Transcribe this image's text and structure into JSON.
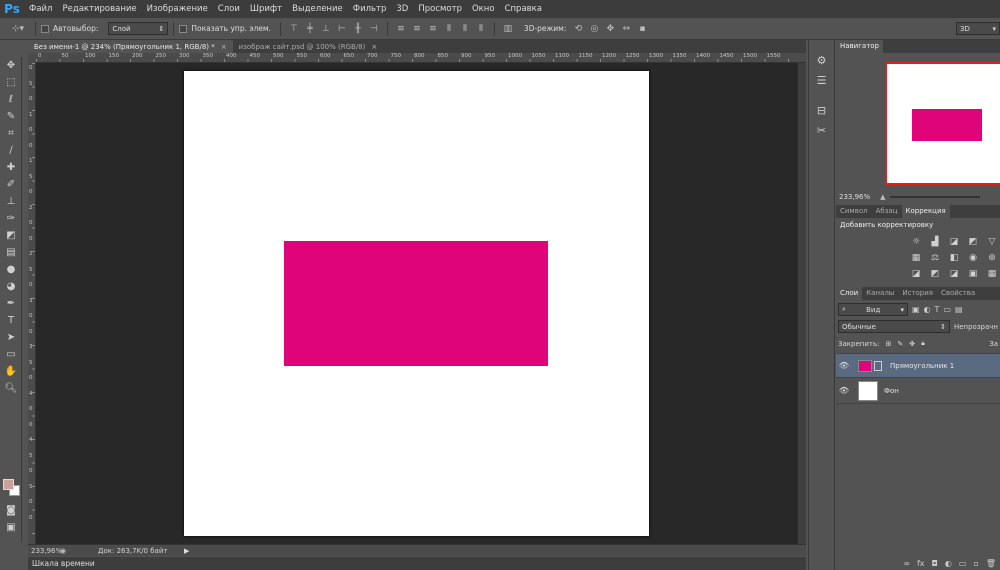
{
  "app": {
    "logo": "Ps",
    "menu": [
      "Файл",
      "Редактирование",
      "Изображение",
      "Слои",
      "Шрифт",
      "Выделение",
      "Фильтр",
      "3D",
      "Просмотр",
      "Окно",
      "Справка"
    ]
  },
  "options": {
    "autoselect_label": "Автовыбор:",
    "autoselect_value": "Слой",
    "show_transform_label": "Показать упр. элем.",
    "mode3d_label": "3D-режим:",
    "workspace_value": "3D"
  },
  "tabs": [
    {
      "label": "Без имени-1 @ 234% (Прямоугольник 1, RGB/8) *",
      "close": "×"
    },
    {
      "label": "изображ сайт.psd @ 100% (RGB/8)",
      "close": "×"
    }
  ],
  "ruler": {
    "h": [
      "0",
      "50",
      "100",
      "150",
      "200",
      "250",
      "300",
      "350",
      "400",
      "450",
      "500",
      "550",
      "600",
      "650",
      "700",
      "750",
      "800",
      "850",
      "900",
      "950",
      "1000",
      "1050",
      "1100",
      "1150",
      "1200",
      "1250",
      "1300",
      "1350",
      "1400",
      "1450",
      "1500",
      "1550"
    ],
    "v": [
      "0",
      "5",
      "0",
      "1",
      "0",
      "0",
      "1",
      "5",
      "0",
      "2",
      "0",
      "0",
      "2",
      "5",
      "0",
      "3",
      "0",
      "0",
      "3",
      "5",
      "0",
      "4",
      "0",
      "0",
      "4",
      "5",
      "0",
      "5",
      "0",
      "0"
    ]
  },
  "canvas": {
    "shape_color": "#e0047a",
    "document_color": "#ffffff"
  },
  "status": {
    "zoom": "233,96%",
    "doc": "Док: 263,7K/0 байт"
  },
  "timeline_label": "Шкала времени",
  "navigator": {
    "tab": "Навигатор",
    "zoom": "233,96%"
  },
  "adjust": {
    "tabs": [
      "Символ",
      "Абзац",
      "Коррекция"
    ],
    "title": "Добавить корректировку"
  },
  "layers": {
    "tabs": [
      "Слои",
      "Каналы",
      "История",
      "Свойства"
    ],
    "filter": "Вид",
    "blend_mode": "Обычные",
    "opacity_label": "Непрозрачн",
    "lock_label": "Закрепить:",
    "fill_label": "За",
    "items": [
      {
        "name": "Прямоугольник 1",
        "selected": true
      },
      {
        "name": "Фон",
        "selected": false
      }
    ],
    "footer_icons": [
      "link-icon",
      "fx-icon",
      "mask-icon",
      "adjustment-icon",
      "folder-icon",
      "new-layer-icon",
      "trash-icon"
    ]
  },
  "colors": {
    "foreground": "#c9a09a",
    "background": "#ffffff",
    "accent": "#31a8ff"
  }
}
